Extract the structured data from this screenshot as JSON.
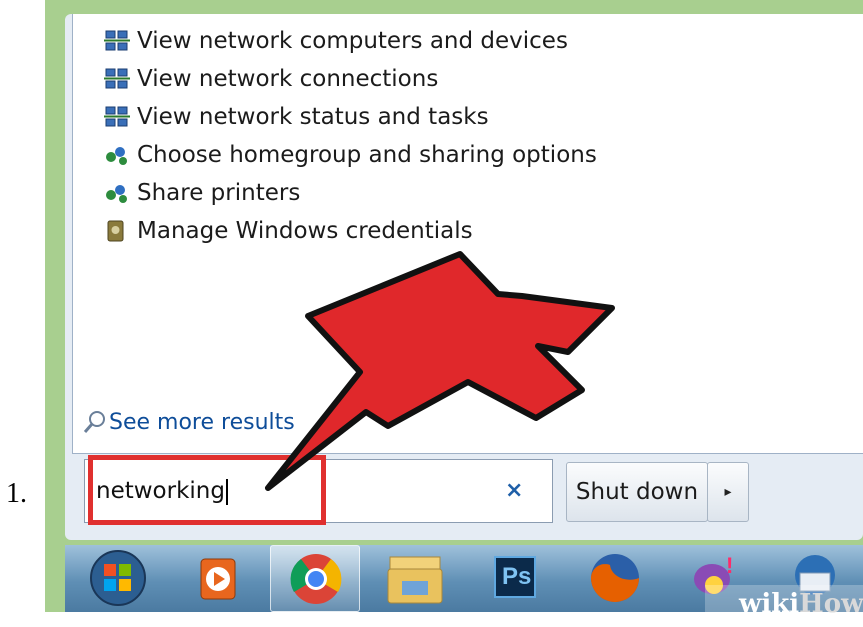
{
  "list_number": "1.",
  "results": [
    {
      "label": "View network computers and devices",
      "icon": "network-icon"
    },
    {
      "label": "View network connections",
      "icon": "network-icon"
    },
    {
      "label": "View network status and tasks",
      "icon": "network-icon"
    },
    {
      "label": "Choose homegroup and sharing options",
      "icon": "homegroup-icon"
    },
    {
      "label": "Share printers",
      "icon": "homegroup-icon"
    },
    {
      "label": "Manage Windows credentials",
      "icon": "credentials-icon"
    }
  ],
  "see_more": "See more results",
  "search": {
    "value": "networking",
    "clear_symbol": "×"
  },
  "shutdown": {
    "label": "Shut down",
    "arrow": "▸"
  },
  "taskbar": [
    {
      "name": "start-orb-icon"
    },
    {
      "name": "media-player-icon"
    },
    {
      "name": "chrome-icon"
    },
    {
      "name": "file-explorer-icon"
    },
    {
      "name": "photoshop-icon",
      "text": "Ps"
    },
    {
      "name": "firefox-icon"
    },
    {
      "name": "yahoo-messenger-icon"
    },
    {
      "name": "thunderbird-icon"
    }
  ],
  "watermark": {
    "wiki": "wiki",
    "how": "How"
  },
  "colors": {
    "highlight": "#e0302f",
    "arrow": "#e0282b",
    "frame": "#a8cf8f",
    "link": "#0e4d99"
  }
}
